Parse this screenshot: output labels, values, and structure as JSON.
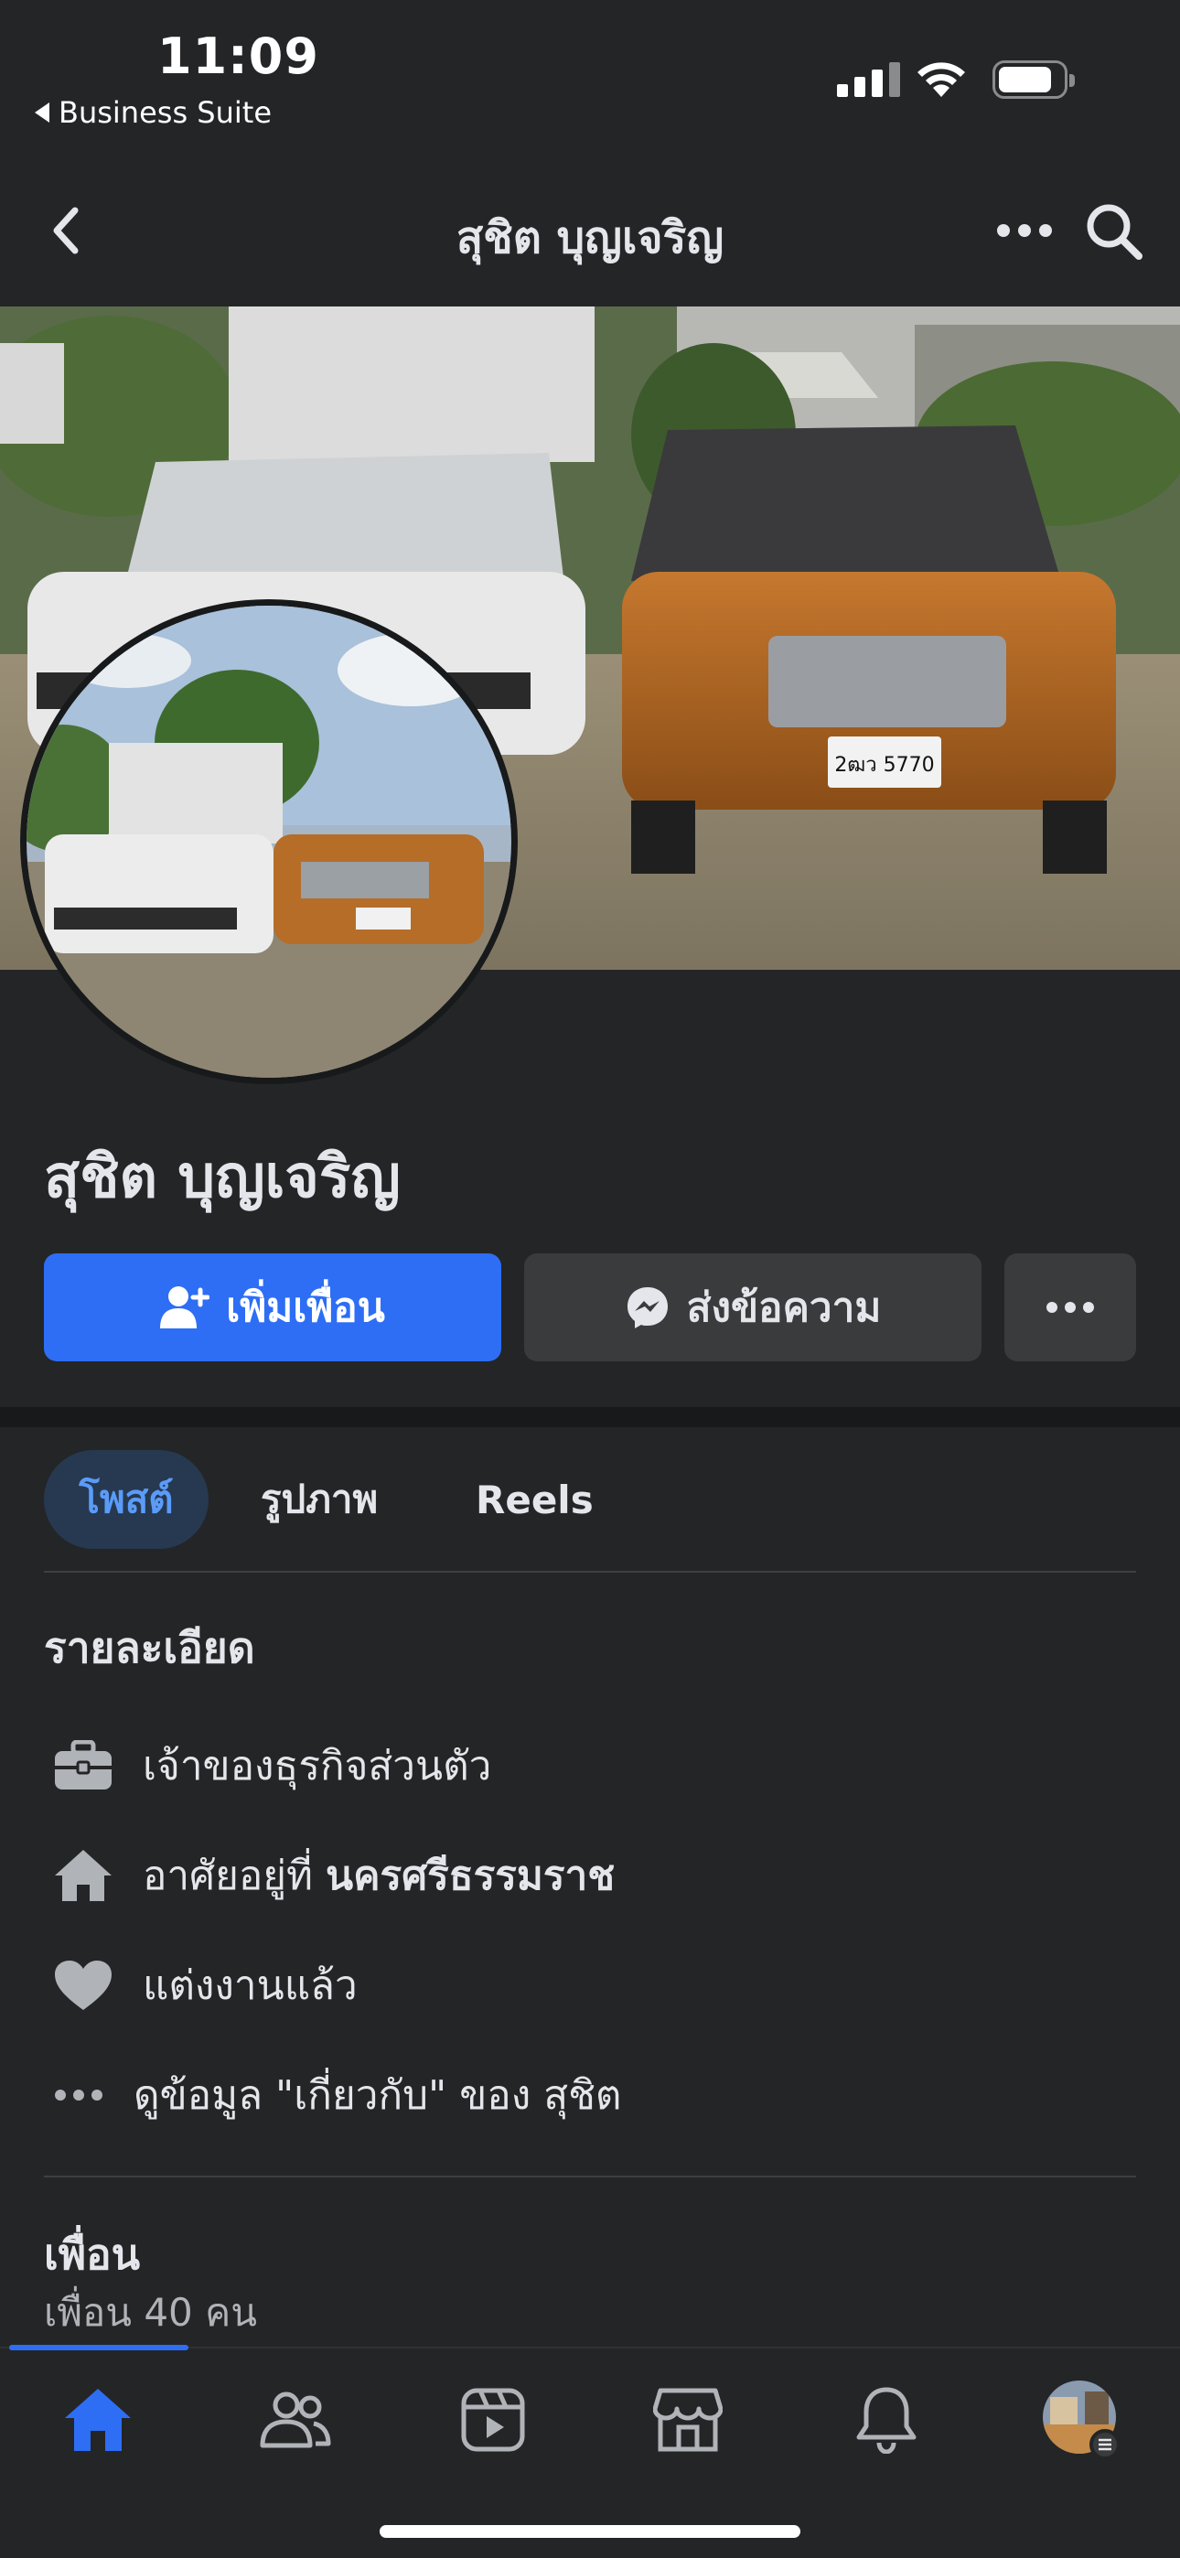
{
  "status": {
    "time": "11:09",
    "back_app": "Business Suite"
  },
  "header": {
    "title": "สุชิต บุญเจริญ"
  },
  "profile": {
    "name": "สุชิต บุญเจริญ",
    "add_friend_label": "เพิ่มเพื่อน",
    "message_label": "ส่งข้อความ",
    "plate_text": "2ฒว 5770"
  },
  "tabs": [
    {
      "label": "โพสต์",
      "selected": true
    },
    {
      "label": "รูปภาพ",
      "selected": false
    },
    {
      "label": "Reels",
      "selected": false
    }
  ],
  "details": {
    "title": "รายละเอียด",
    "items": [
      {
        "icon": "briefcase-icon",
        "text": "เจ้าของธุรกิจส่วนตัว"
      },
      {
        "icon": "home-icon",
        "prefix": "อาศัยอยู่ที่ ",
        "bold": "นครศรีธรรมราช"
      },
      {
        "icon": "heart-icon",
        "text": "แต่งงานแล้ว"
      },
      {
        "icon": "more-dots-icon",
        "text": "ดูข้อมูล \"เกี่ยวกับ\" ของ สุชิต"
      }
    ]
  },
  "friends": {
    "title": "เพื่อน",
    "count_label": "เพื่อน 40 คน"
  },
  "bottom_nav": [
    {
      "icon": "home-icon",
      "active": true
    },
    {
      "icon": "friends-icon",
      "active": false
    },
    {
      "icon": "video-icon",
      "active": false
    },
    {
      "icon": "marketplace-icon",
      "active": false
    },
    {
      "icon": "bell-icon",
      "active": false
    },
    {
      "icon": "profile-avatar-icon",
      "active": false
    }
  ],
  "colors": {
    "accent": "#2d6ef5",
    "background": "#242526",
    "tab_selected_bg": "#263951"
  }
}
